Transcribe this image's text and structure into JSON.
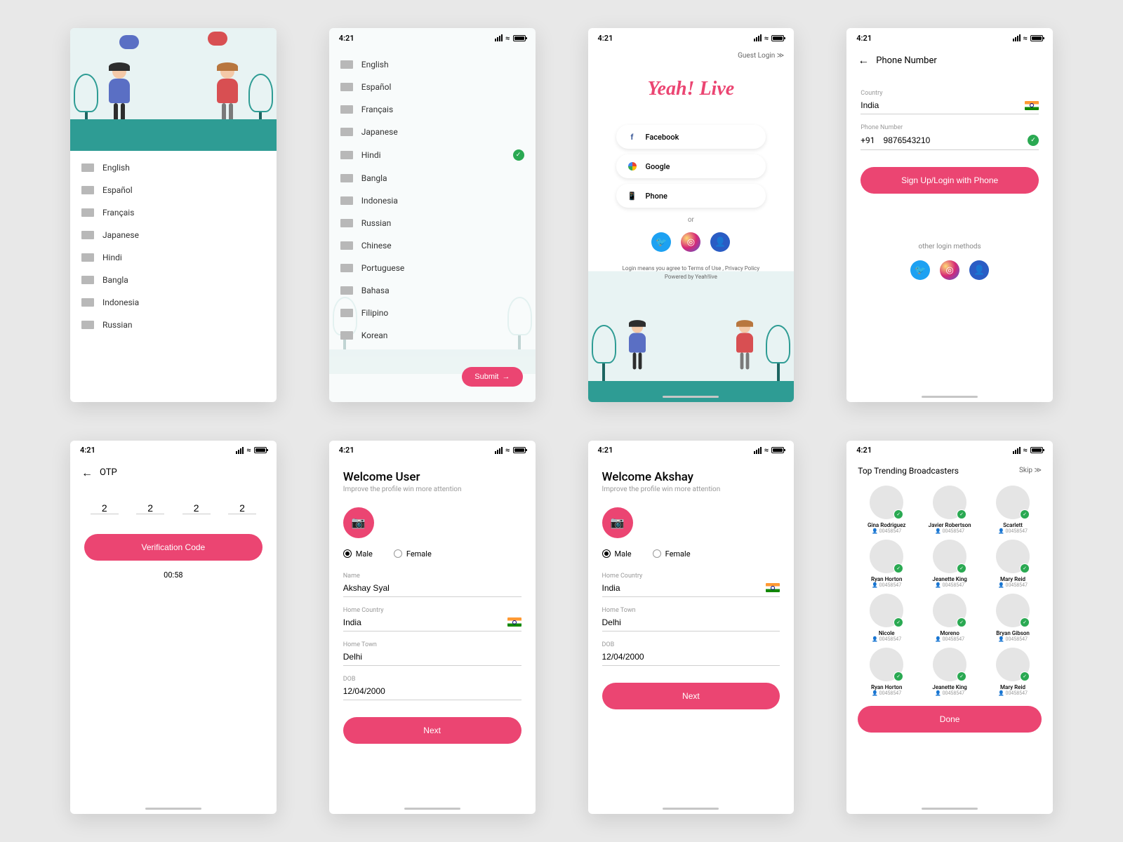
{
  "status_time": "4:21",
  "screen1": {
    "languages": [
      "English",
      "Español",
      "Français",
      "Japanese",
      "Hindi",
      "Bangla",
      "Indonesia",
      "Russian"
    ]
  },
  "screen2": {
    "languages": [
      "English",
      "Español",
      "Français",
      "Japanese",
      "Hindi",
      "Bangla",
      "Indonesia",
      "Russian",
      "Chinese",
      "Portuguese",
      "Bahasa",
      "Filipino",
      "Korean"
    ],
    "selected_index": 4,
    "submit": "Submit"
  },
  "screen3": {
    "guest": "Guest Login",
    "logo": "Yeah! Live",
    "fb": "Facebook",
    "google": "Google",
    "phone": "Phone",
    "or": "or",
    "terms1": "Login means you agree to Terms of Use , Privacy Policy",
    "terms2": "Powered by  Yeah!live"
  },
  "screen4": {
    "title": "Phone Number",
    "country_label": "Country",
    "country": "India",
    "phone_label": "Phone Number",
    "code": "+91",
    "phone": "9876543210",
    "button": "Sign Up/Login with Phone",
    "other": "other login methods"
  },
  "screen5": {
    "title": "OTP",
    "otp": [
      "2",
      "2",
      "2",
      "2"
    ],
    "button": "Verification Code",
    "timer": "00:58"
  },
  "screen6": {
    "title": "Welcome User",
    "sub": "Improve the profile win more attention",
    "male": "Male",
    "female": "Female",
    "name_label": "Name",
    "name": "Akshay Syal",
    "country_label": "Home Country",
    "country": "India",
    "town_label": "Home Town",
    "town": "Delhi",
    "dob_label": "DOB",
    "dob": "12/04/2000",
    "next": "Next"
  },
  "screen7": {
    "title": "Welcome Akshay",
    "sub": "Improve the profile win more attention",
    "male": "Male",
    "female": "Female",
    "country_label": "Home Country",
    "country": "India",
    "town_label": "Home Town",
    "town": "Delhi",
    "dob_label": "DOB",
    "dob": "12/04/2000",
    "next": "Next"
  },
  "screen8": {
    "title": "Top Trending Broadcasters",
    "skip": "Skip",
    "broadcasters": [
      {
        "name": "Gina Rodriguez",
        "id": "00458547"
      },
      {
        "name": "Javier Robertson",
        "id": "00458547"
      },
      {
        "name": "Scarlett",
        "id": "00458547"
      },
      {
        "name": "Ryan Horton",
        "id": "00458547"
      },
      {
        "name": "Jeanette King",
        "id": "00458547"
      },
      {
        "name": "Mary Reid",
        "id": "00458547"
      },
      {
        "name": "Nicole",
        "id": "00458547"
      },
      {
        "name": "Moreno",
        "id": "00458547"
      },
      {
        "name": "Bryan Gibson",
        "id": "00458547"
      },
      {
        "name": "Ryan Horton",
        "id": "00458547"
      },
      {
        "name": "Jeanette King",
        "id": "00458547"
      },
      {
        "name": "Mary Reid",
        "id": "00458547"
      }
    ],
    "done": "Done"
  }
}
